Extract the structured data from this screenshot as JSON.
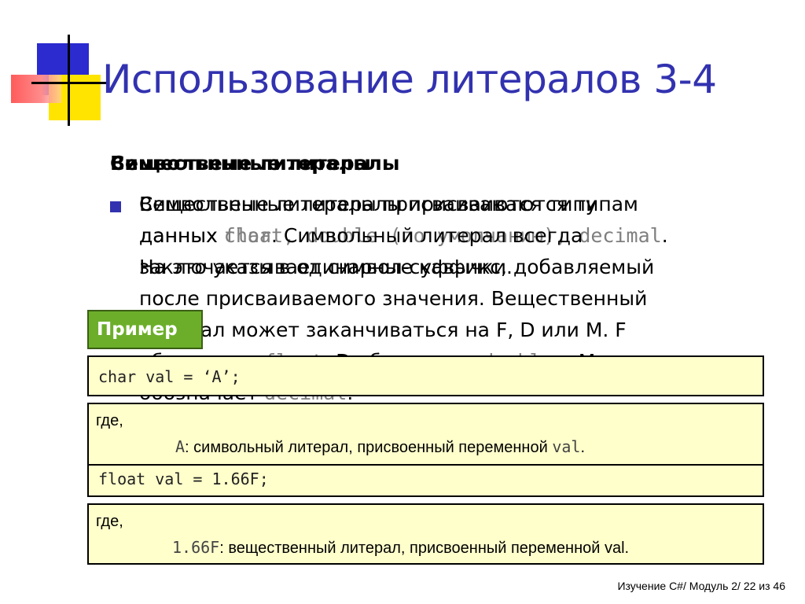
{
  "slide": {
    "title": "Использование литералов 3-4",
    "heading_char": "Символьные литералы",
    "heading_real": "Вещественные литералы",
    "bullet_char_line1": "Символьные литералы присваиваются типу",
    "bullet_char_line2_a": "данных ",
    "bullet_char_line2_code": "char",
    "bullet_char_line2_b": ". Символьный литерал всегда",
    "bullet_char_line3": "заключается в одинарные кавычки.",
    "bullet_real_line1": "Вещественные литералы присваиваются типам",
    "bullet_real_line2_a": "данных ",
    "bullet_real_line2_code": "float, double (по умолчанию), decimal",
    "bullet_real_line2_b": ".",
    "bullet_real_line3": "На это указывает символ-суффикс, добавляемый",
    "bullet_real_line4": "после присваиваемого значения. Вещественный",
    "bullet_real_line5": "литерал может заканчиваться на F, D или M. F",
    "bullet_real_line6_a": "обозначает ",
    "bullet_real_line6_code1": "float",
    "bullet_real_line6_b": ", D обозначает ",
    "bullet_real_line6_code2": "double",
    "bullet_real_line6_c": " и M",
    "bullet_real_line7_a": "обозначает ",
    "bullet_real_line7_code": "decimal",
    "bullet_real_line7_b": "."
  },
  "example": {
    "badge": "Пример",
    "code_char": "char val = ‘A’;",
    "where1": "где,",
    "desc1_code": "A",
    "desc1_text": ": символьный литерал, присвоенный переменной ",
    "desc1_var": "val",
    "desc1_end": ".",
    "code_float": "float val = 1.66F;",
    "where2": "где,",
    "desc2_code": "1.66F",
    "desc2_text": ": вещественный литерал, присвоенный переменной val."
  },
  "footer": "Изучение C#/ Модуль 2/ 22 из 46",
  "colors": {
    "title": "#3232b0",
    "badge": "#6cae2a",
    "box": "#ffffcc"
  }
}
